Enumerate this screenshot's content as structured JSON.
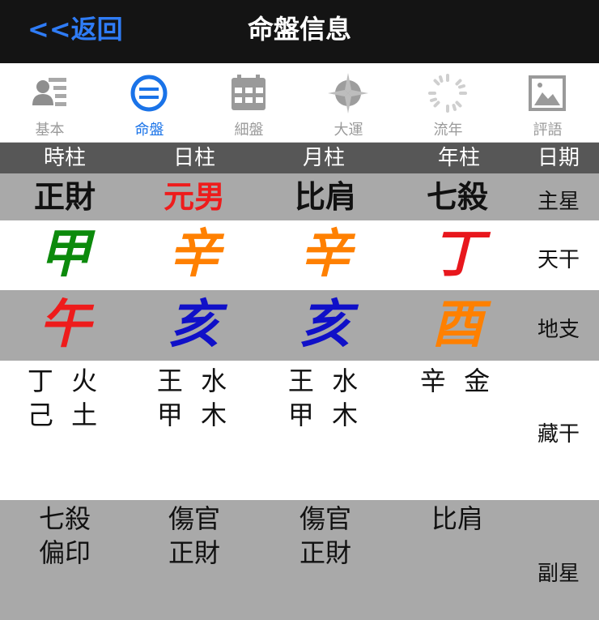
{
  "nav": {
    "back_label": "<<返回",
    "title": "命盤信息"
  },
  "tabs": [
    {
      "label": "基本",
      "icon": "profile-list-icon",
      "active": false
    },
    {
      "label": "命盤",
      "icon": "chart-disc-icon",
      "active": true
    },
    {
      "label": "細盤",
      "icon": "calendar-grid-icon",
      "active": false
    },
    {
      "label": "大運",
      "icon": "compass-icon",
      "active": false
    },
    {
      "label": "流年",
      "icon": "sun-rays-icon",
      "active": false
    },
    {
      "label": "評語",
      "icon": "picture-icon",
      "active": false
    }
  ],
  "columns": [
    "時柱",
    "日柱",
    "月柱",
    "年柱",
    "日期"
  ],
  "main_star": {
    "label": "主星",
    "values": [
      "正財",
      "元男",
      "比肩",
      "七殺"
    ],
    "colors": [
      "#111111",
      "#ee1c1c",
      "#111111",
      "#111111"
    ]
  },
  "heavenly_stem": {
    "label": "天干",
    "values": [
      "甲",
      "辛",
      "辛",
      "丁"
    ],
    "colors": [
      "#0c8a0c",
      "#ff8000",
      "#ff8000",
      "#e8171d"
    ]
  },
  "earthly_branch": {
    "label": "地支",
    "values": [
      "午",
      "亥",
      "亥",
      "酉"
    ],
    "colors": [
      "#ee1c1c",
      "#1010c8",
      "#1010c8",
      "#ff8000"
    ]
  },
  "hidden_stems": {
    "label": "藏干",
    "values": [
      [
        "丁 火",
        "己 土"
      ],
      [
        "王 水",
        "甲 木"
      ],
      [
        "王 水",
        "甲 木"
      ],
      [
        "辛 金"
      ]
    ]
  },
  "sub_star": {
    "label": "副星",
    "values": [
      [
        "七殺",
        "偏印"
      ],
      [
        "傷官",
        "正財"
      ],
      [
        "傷官",
        "正財"
      ],
      [
        "比肩"
      ]
    ]
  }
}
